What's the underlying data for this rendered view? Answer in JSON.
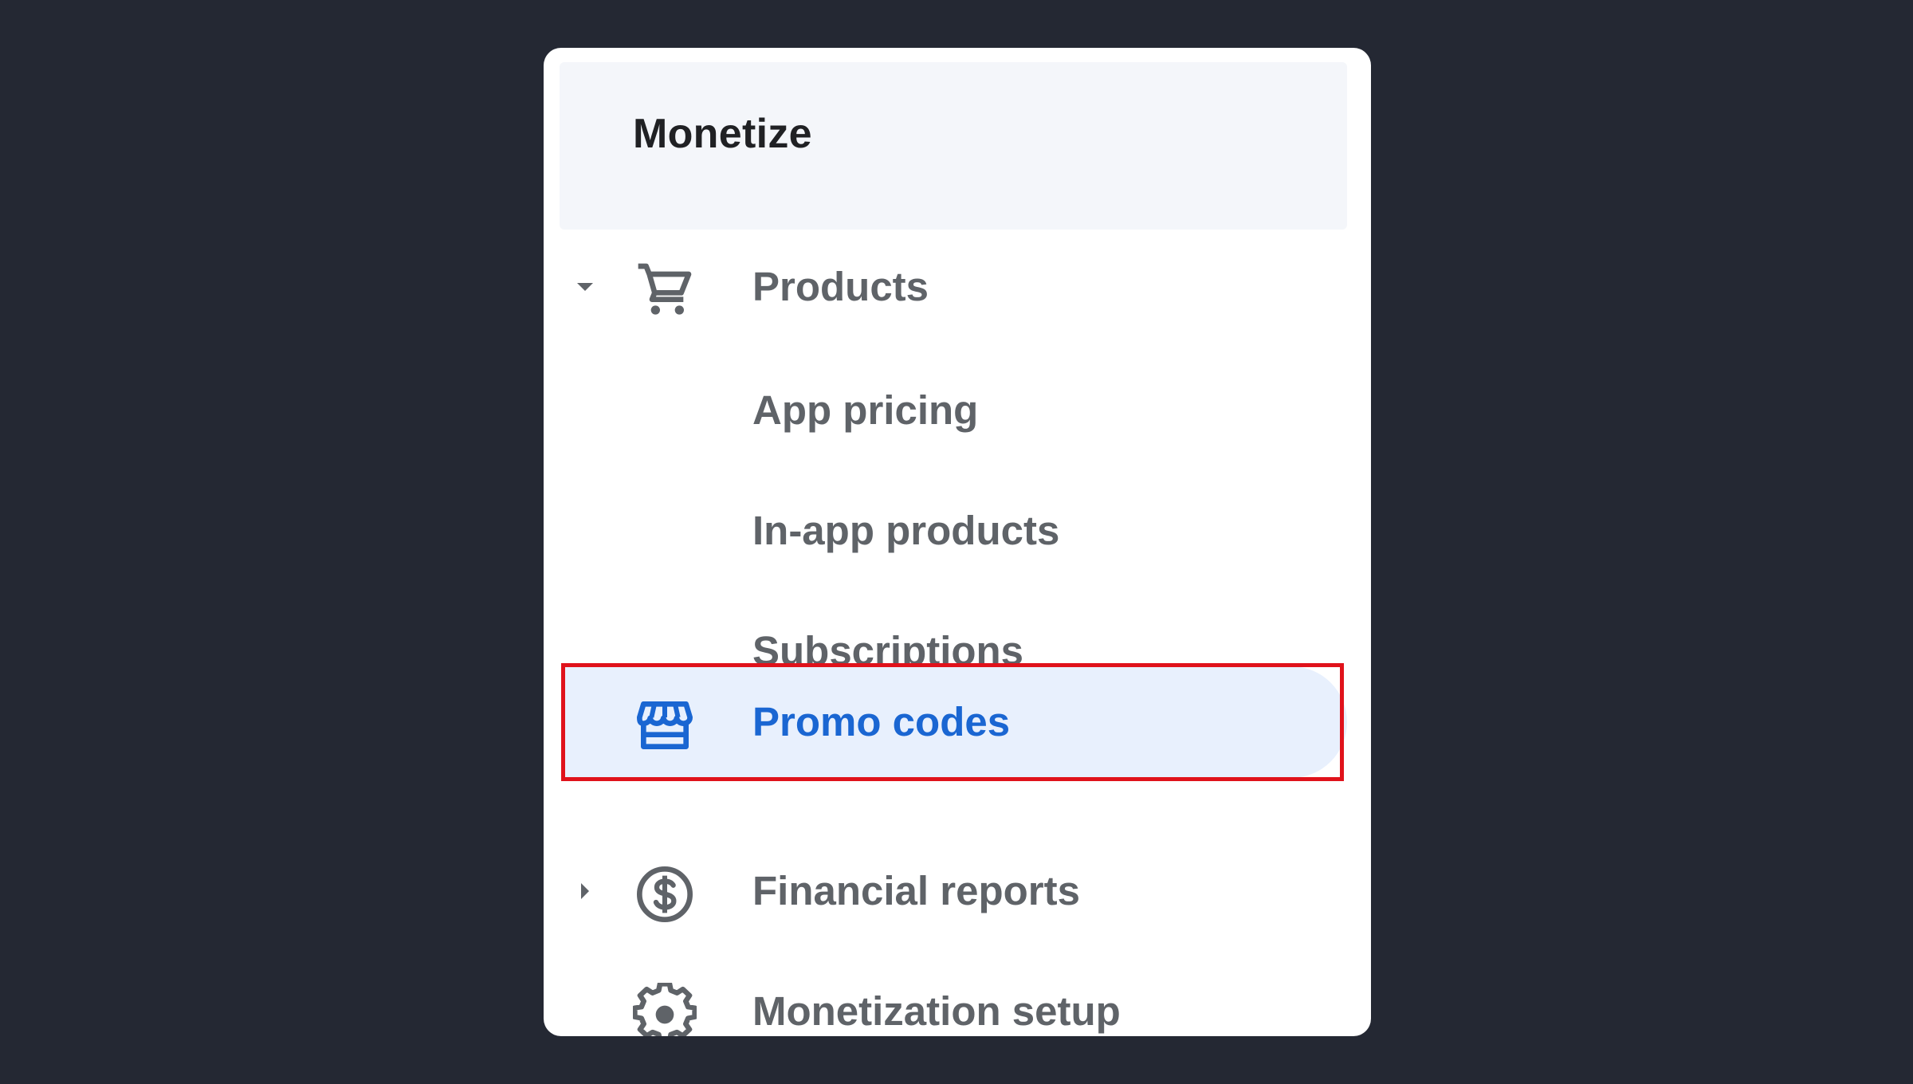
{
  "section": {
    "title": "Monetize"
  },
  "nav": {
    "items": [
      {
        "label": "Products",
        "icon": "cart-icon",
        "caret": "caret-down-icon",
        "expanded": true
      },
      {
        "label": "App pricing",
        "icon": null
      },
      {
        "label": "In-app products",
        "icon": null
      },
      {
        "label": "Subscriptions",
        "icon": null
      },
      {
        "label": "Promo codes",
        "icon": "storefront-icon",
        "active": true
      },
      {
        "label": "Financial reports",
        "icon": "dollar-circle-icon",
        "caret": "caret-right-icon",
        "expanded": false
      },
      {
        "label": "Monetization setup",
        "icon": "gear-icon"
      }
    ]
  },
  "colors": {
    "background": "#242833",
    "card": "#ffffff",
    "header_bg": "#f4f6fa",
    "text_primary": "#202124",
    "text_secondary": "#5f6368",
    "active_text": "#1a66d2",
    "active_bg": "#e8f0fd",
    "highlight_border": "#e0121b"
  }
}
